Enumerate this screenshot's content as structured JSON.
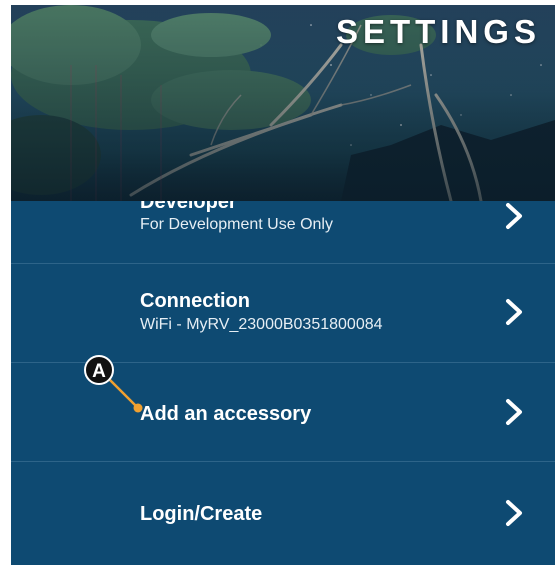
{
  "header": {
    "title": "SETTINGS"
  },
  "rows": [
    {
      "title": "Developer",
      "subtitle": "For Development Use Only",
      "icon": "chevron-right-icon"
    },
    {
      "title": "Connection",
      "subtitle": "WiFi - MyRV_23000B0351800084",
      "icon": "chevron-right-icon"
    },
    {
      "title": "Add an accessory",
      "subtitle": "",
      "icon": "chevron-right-icon"
    },
    {
      "title": "Login/Create",
      "subtitle": "",
      "icon": "chevron-right-icon"
    }
  ],
  "annotation": {
    "label": "A",
    "color": "#f0a030"
  },
  "colors": {
    "background": "#0e4a72",
    "divider": "#2d6489",
    "text": "#ffffff"
  }
}
